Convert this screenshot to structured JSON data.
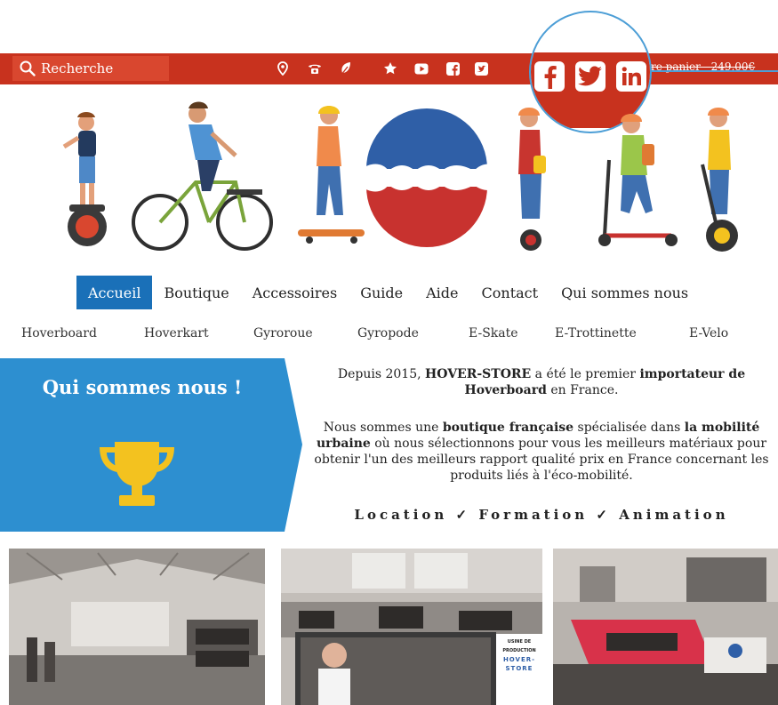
{
  "search": {
    "placeholder": "Recherche"
  },
  "topbar": {
    "icons": [
      "location-icon",
      "phone-icon",
      "leaf-icon",
      "star-icon",
      "youtube-icon",
      "facebook-icon",
      "twitter-icon"
    ],
    "cart_text": "re panier - 249,00€"
  },
  "zoom": {
    "icons": [
      "facebook-icon",
      "twitter-icon",
      "linkedin-icon"
    ]
  },
  "nav": {
    "items": [
      "Accueil",
      "Boutique",
      "Accessoires",
      "Guide",
      "Aide",
      "Contact",
      "Qui sommes nous"
    ],
    "active": "Accueil"
  },
  "subnav": {
    "items": [
      "Hoverboard",
      "Hoverkart",
      "Gyroroue",
      "Gyropode",
      "E-Skate",
      "E-Trottinette",
      "E-Velo"
    ]
  },
  "about": {
    "title": "Qui sommes nous !",
    "p1": [
      "Depuis 2015, ",
      "HOVER-STORE",
      " a été le premier ",
      "importateur de",
      "Hoverboard",
      " en France."
    ],
    "p2": [
      "Nous sommes une ",
      "boutique française",
      " spécialisée dans ",
      "la mobilité",
      "urbaine",
      " où nous sélectionnons pour vous les meilleurs matériaux pour",
      "obtenir l'un des meilleurs rapport qualité prix en France concernant les",
      "produits liés à l'éco-mobilité."
    ],
    "services": "Location ✓ Formation ✓ Animation"
  },
  "photos": {
    "overlay_title_line1": "USINE DE PRODUCTION",
    "overlay_title_line2": "HOVER-STORE"
  },
  "colors": {
    "topbar": "#c8321e",
    "nav_active": "#1a70b8",
    "about_panel": "#2d8fd0",
    "zoom_ring": "#4c9ed6",
    "trophy": "#f3c21f"
  }
}
